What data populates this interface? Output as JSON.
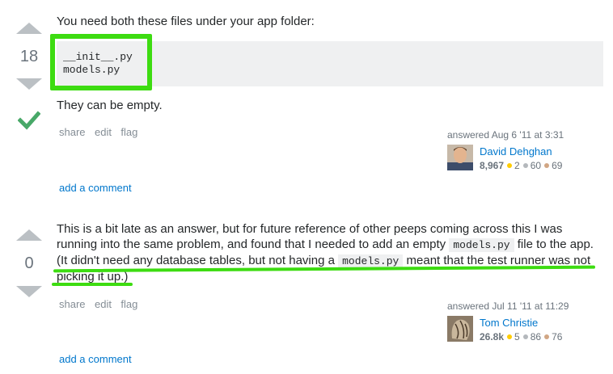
{
  "answers": [
    {
      "votes": "18",
      "accepted": true,
      "intro": "You need both these files under your app folder:",
      "code_lines": [
        "__init__.py",
        "models.py"
      ],
      "outro": "They can be empty.",
      "menu": [
        "share",
        "edit",
        "flag"
      ],
      "answered": "answered Aug 6 '11 at 3:31",
      "user": {
        "name": "David Dehghan",
        "reputation": "8,967",
        "gold": "2",
        "silver": "60",
        "bronze": "69"
      },
      "add_comment": "add a comment"
    },
    {
      "votes": "0",
      "accepted": false,
      "text_parts": [
        "This is a bit late as an answer, but for future reference of other peeps coming across this I was",
        "running into the same problem, and found that I needed to add an empty ",
        "models.py",
        " file to the app.",
        "(It didn't need any database tables, but not having a ",
        "models.py",
        " meant that the test runner was not",
        "picking it up.)"
      ],
      "menu": [
        "share",
        "edit",
        "flag"
      ],
      "answered": "answered Jul 11 '11 at 11:29",
      "user": {
        "name": "Tom Christie",
        "reputation": "26.8k",
        "gold": "5",
        "silver": "86",
        "bronze": "76"
      },
      "add_comment": "add a comment"
    }
  ],
  "colors": {
    "highlight": "#3ddc11",
    "accepted": "#48a868",
    "link": "#0077cc",
    "code_bg": "#eff0f1"
  },
  "icons": [
    "vote-up-icon",
    "vote-down-icon",
    "accepted-check-icon",
    "avatar"
  ]
}
